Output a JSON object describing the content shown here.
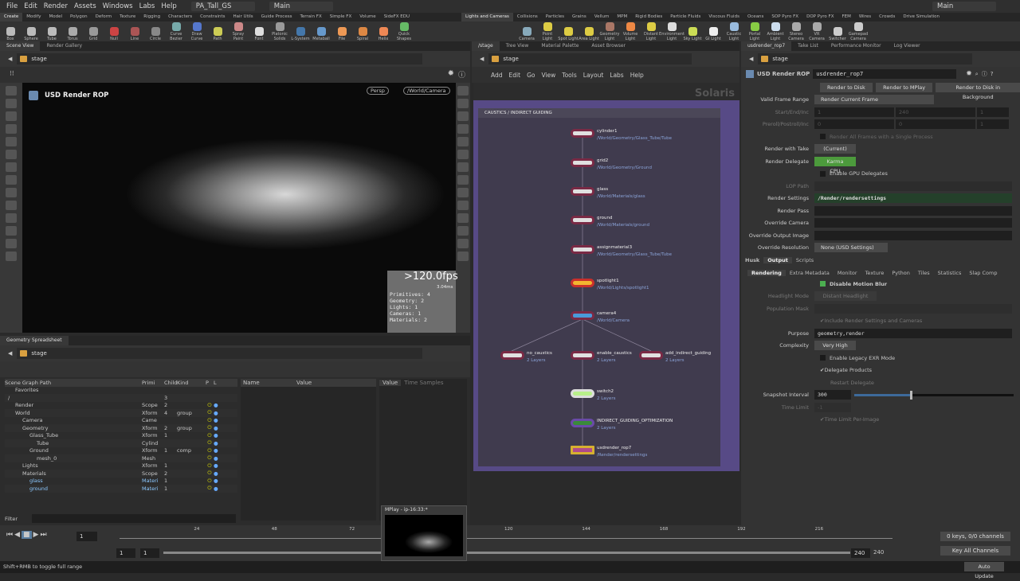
{
  "menu": {
    "items": [
      "File",
      "Edit",
      "Render",
      "Assets",
      "Windows",
      "Labs",
      "Help"
    ],
    "desktop": "PA_Tall_GS",
    "context": "Main",
    "context_right": "Main"
  },
  "shelf_left": {
    "tabs": [
      "Create",
      "Modify",
      "Model",
      "Polygon",
      "Deform",
      "Texture",
      "Rigging",
      "Characters",
      "Constraints",
      "Hair Utils",
      "Guide Process",
      "Terrain FX",
      "Simple FX",
      "Volume",
      "SideFX EDU"
    ],
    "tools": [
      "Box",
      "Sphere",
      "Tube",
      "Torus",
      "Grid",
      "Null",
      "Line",
      "Circle",
      "Curve Bezier",
      "Draw Curve",
      "Path",
      "Spray Paint",
      "Font",
      "Platonic Solids",
      "L-System",
      "Metaball",
      "File",
      "Spiral",
      "Helix",
      "Quick Shapes"
    ]
  },
  "shelf_right": {
    "tabs": [
      "Lights and Cameras",
      "Collisions",
      "Particles",
      "Grains",
      "Vellum",
      "MPM",
      "Rigid Bodies",
      "Particle Fluids",
      "Viscous Fluids",
      "Oceans",
      "SOP Pyro FX",
      "DOP Pyro FX",
      "FEM",
      "Wires",
      "Crowds",
      "Drive Simulation"
    ],
    "tools": [
      "Camera",
      "Point Light",
      "Spot Light",
      "Area Light",
      "Geometry Light",
      "Volume Light",
      "Distant Light",
      "Environment Light",
      "Sky Light",
      "GI Light",
      "Caustic Light",
      "Portal Light",
      "Ambient Light",
      "Stereo Camera",
      "VR Camera",
      "Switcher",
      "Gamepad Camera"
    ]
  },
  "scene_view": {
    "tabs": [
      "Scene View",
      "Render Gallery"
    ],
    "path": "stage",
    "title": "USD Render ROP",
    "persp": "Persp",
    "camera": "/World/Camera",
    "fps": ">120.0fps",
    "ms": "3.04ms",
    "stats": [
      "Primitives:   4",
      "Geometry:     2",
      "Lights:       1",
      "Cameras:      1",
      "Materials:    2"
    ]
  },
  "spreadsheet": {
    "tabs": [
      "Geometry Spreadsheet"
    ],
    "path": "stage",
    "headers": [
      "Scene Graph Path",
      "Primi",
      "Child",
      "Kind",
      "P",
      "L"
    ],
    "rows": [
      [
        "Favorites",
        "",
        "",
        ""
      ],
      [
        "/",
        "",
        "3",
        ""
      ],
      [
        "Render",
        "Scope",
        "2",
        ""
      ],
      [
        "World",
        "Xform",
        "4",
        "group"
      ],
      [
        "Camera",
        "Came",
        "",
        ""
      ],
      [
        "Geometry",
        "Xform",
        "2",
        "group"
      ],
      [
        "Glass_Tube",
        "Xform",
        "1",
        ""
      ],
      [
        "Tube",
        "Cylind",
        "",
        ""
      ],
      [
        "Ground",
        "Xform",
        "1",
        "comp"
      ],
      [
        "mesh_0",
        "Mesh",
        "",
        ""
      ],
      [
        "Lights",
        "Xform",
        "1",
        ""
      ],
      [
        "Materials",
        "Scope",
        "2",
        ""
      ],
      [
        "glass",
        "Materi",
        "1",
        ""
      ],
      [
        "ground",
        "Materi",
        "1",
        ""
      ]
    ],
    "prop_headers": [
      "Name",
      "Value"
    ],
    "value_tabs": [
      "Value",
      "Time Samples"
    ],
    "filter": "Filter"
  },
  "network": {
    "tabs": [
      "/stage",
      "Tree View",
      "Material Palette",
      "Asset Browser"
    ],
    "path": "stage",
    "menu": [
      "Add",
      "Edit",
      "Go",
      "View",
      "Tools",
      "Layout",
      "Labs",
      "Help"
    ],
    "watermark": "Solaris",
    "box_title": "CAUSTICS / INDIRECT GUIDING",
    "nodes": [
      {
        "name": "cylinder1",
        "sub": "/World/Geometry/Glass_Tube/Tube"
      },
      {
        "name": "grid2",
        "sub": "/World/Geometry/Ground"
      },
      {
        "name": "glass",
        "sub": "/World/Materials/glass"
      },
      {
        "name": "ground",
        "sub": "/World/Materials/ground"
      },
      {
        "name": "assignmaterial3",
        "sub": "/World/Geometry/Glass_Tube/Tube"
      },
      {
        "name": "spotlight1",
        "sub": "/World/Lights/spotlight1"
      },
      {
        "name": "camera4",
        "sub": "/World/Camera"
      },
      {
        "name": "no_caustics",
        "sub": "2 Layers"
      },
      {
        "name": "enable_caustics",
        "sub": "2 Layers"
      },
      {
        "name": "add_indirect_guiding",
        "sub": "2 Layers"
      },
      {
        "name": "switch2",
        "sub": "2 Layers"
      },
      {
        "name": "INDIRECT_GUIDING_OPTIMIZATION",
        "sub": "2 Layers"
      },
      {
        "name": "usdrender_rop7",
        "sub": "/Render/rendersettings"
      }
    ]
  },
  "params": {
    "tabs": [
      "usdrender_rop7",
      "Take List",
      "Performance Monitor",
      "Log Viewer"
    ],
    "path": "stage",
    "type": "USD Render ROP",
    "name": "usdrender_rop7",
    "buttons": [
      "Render to Disk",
      "Render to MPlay",
      "Render to Disk in Background"
    ],
    "valid_frame_range_label": "Valid Frame Range",
    "valid_frame_range": "Render Current Frame",
    "start_label": "Start/End/Inc",
    "start": [
      "1",
      "240",
      "1"
    ],
    "preroll_label": "Preroll/Postroll/Inc",
    "preroll": [
      "0",
      "0",
      "1"
    ],
    "single_process": "Render All Frames with a Single Process",
    "take_label": "Render with Take",
    "take": "(Current)",
    "delegate_label": "Render Delegate",
    "delegate": "Karma CPU",
    "gpu": "Enable GPU Delegates",
    "lop_label": "LOP Path",
    "settings_label": "Render Settings",
    "settings": "/Render/rendersettings",
    "pass_label": "Render Pass",
    "camera_label": "Override Camera",
    "output_label": "Override Output Image",
    "res_label": "Override Resolution",
    "res": "None (USD Settings)",
    "section_tabs": [
      "Husk",
      "Output",
      "Scripts"
    ],
    "sub_tabs": [
      "Rendering",
      "Extra Metadata",
      "Monitor",
      "Texture",
      "Python",
      "Tiles",
      "Statistics",
      "Slap Comp"
    ],
    "motion_blur": "Disable Motion Blur",
    "headlight_label": "Headlight Mode",
    "headlight": "Distant Headlight",
    "population_label": "Population Mask",
    "include": "Include Render Settings and Cameras",
    "purpose_label": "Purpose",
    "purpose": "geometry,render",
    "complexity_label": "Complexity",
    "complexity": "Very High",
    "legacy": "Enable Legacy EXR Mode",
    "delegate_products": "Delegate Products",
    "restart": "Restart Delegate",
    "snapshot_label": "Snapshot Interval",
    "snapshot": "300",
    "snapshot_fraction": 0.35,
    "timelimit_label": "Time Limit",
    "timelimit": "-1",
    "per_image": "Time Limit Per-Image"
  },
  "timeline": {
    "frame": "1",
    "ticks": [
      "24",
      "48",
      "72",
      "120",
      "144",
      "168",
      "192",
      "216"
    ],
    "start": "1",
    "start2": "1",
    "end": "240",
    "end2": "240",
    "keys": "0 keys, 0/0 channels",
    "key_all": "Key All Channels",
    "auto_update": "Auto Update",
    "mplay": "MPlay - ip-16:33:*"
  },
  "status": "Shift+RMB to toggle full range"
}
